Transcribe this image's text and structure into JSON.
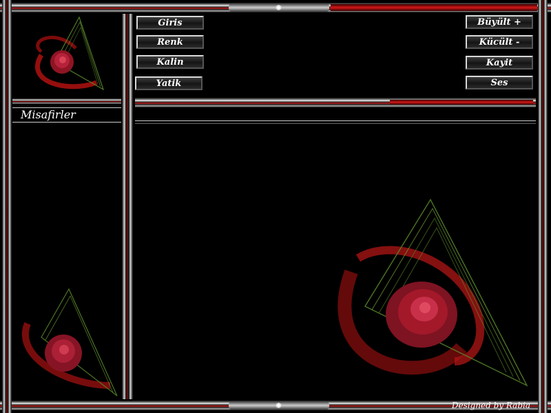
{
  "buttons_left": [
    "Giris",
    "Renk",
    "Kalin",
    "Yatik"
  ],
  "buttons_right": [
    "Büyült +",
    "Kücült -",
    "Kayit",
    "Ses"
  ],
  "sidebar": {
    "title": "Misafirler"
  },
  "footer": {
    "credit": "Designed by Rabia"
  },
  "ornament_glyph": "✺",
  "colors": {
    "accent": "#c01515",
    "background": "#000000",
    "silver": "#d9d9d9",
    "leaf": "#5a8a2a",
    "rose": "#a3192a"
  },
  "decorations": [
    "rose-icon",
    "ribbon-icon"
  ]
}
